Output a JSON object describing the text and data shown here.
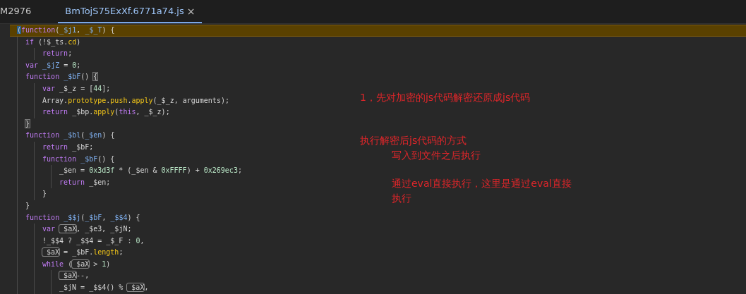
{
  "tabs": [
    {
      "label": "M2976",
      "selected": false
    },
    {
      "label": "BmTojS75ExXf.6771a74.js",
      "selected": true,
      "close_glyph": "×"
    }
  ],
  "code": {
    "lines": [
      {
        "highlighted": true,
        "tokens": [
          {
            "kind": "cursor",
            "text": "("
          },
          {
            "kind": "kw",
            "text": "function"
          },
          {
            "kind": "plain",
            "text": "("
          },
          {
            "kind": "var",
            "text": "_$j1"
          },
          {
            "kind": "plain",
            "text": ", "
          },
          {
            "kind": "var",
            "text": "_$_T"
          },
          {
            "kind": "plain",
            "text": ") {"
          }
        ],
        "children": [
          {
            "highlighted": false,
            "tokens": [
              {
                "kind": "kw",
                "text": "if"
              },
              {
                "kind": "plain",
                "text": " (!$_ts."
              },
              {
                "kind": "prop",
                "text": "cd"
              },
              {
                "kind": "plain",
                "text": ")"
              }
            ],
            "children": [
              {
                "highlighted": false,
                "tokens": [
                  {
                    "kind": "kw",
                    "text": "return"
                  },
                  {
                    "kind": "plain",
                    "text": ";"
                  }
                ]
              }
            ]
          },
          {
            "highlighted": false,
            "tokens": [
              {
                "kind": "kw",
                "text": "var "
              },
              {
                "kind": "var",
                "text": "_$jZ"
              },
              {
                "kind": "plain",
                "text": " = "
              },
              {
                "kind": "num",
                "text": "0"
              },
              {
                "kind": "plain",
                "text": ";"
              }
            ]
          },
          {
            "highlighted": false,
            "tokens": [
              {
                "kind": "kw",
                "text": "function "
              },
              {
                "kind": "var",
                "text": "_$bF"
              },
              {
                "kind": "plain",
                "text": "() "
              },
              {
                "kind": "bracket",
                "text": "{"
              }
            ],
            "children": [
              {
                "highlighted": false,
                "tokens": [
                  {
                    "kind": "kw",
                    "text": "var"
                  },
                  {
                    "kind": "plain",
                    "text": " _$_z = ["
                  },
                  {
                    "kind": "num",
                    "text": "44"
                  },
                  {
                    "kind": "plain",
                    "text": "];"
                  }
                ]
              },
              {
                "highlighted": false,
                "tokens": [
                  {
                    "kind": "plain",
                    "text": "Array."
                  },
                  {
                    "kind": "prop",
                    "text": "prototype"
                  },
                  {
                    "kind": "plain",
                    "text": "."
                  },
                  {
                    "kind": "prop",
                    "text": "push"
                  },
                  {
                    "kind": "plain",
                    "text": "."
                  },
                  {
                    "kind": "prop",
                    "text": "apply"
                  },
                  {
                    "kind": "plain",
                    "text": "(_$_z, arguments);"
                  }
                ]
              },
              {
                "highlighted": false,
                "tokens": [
                  {
                    "kind": "kw",
                    "text": "return"
                  },
                  {
                    "kind": "plain",
                    "text": " _$bp."
                  },
                  {
                    "kind": "prop",
                    "text": "apply"
                  },
                  {
                    "kind": "plain",
                    "text": "("
                  },
                  {
                    "kind": "kw",
                    "text": "this"
                  },
                  {
                    "kind": "plain",
                    "text": ", _$_z);"
                  }
                ]
              }
            ]
          },
          {
            "highlighted": false,
            "tokens": [
              {
                "kind": "bracket",
                "text": "}"
              }
            ]
          },
          {
            "highlighted": false,
            "tokens": [
              {
                "kind": "kw",
                "text": "function "
              },
              {
                "kind": "var",
                "text": "_$bl"
              },
              {
                "kind": "plain",
                "text": "("
              },
              {
                "kind": "var",
                "text": "_$en"
              },
              {
                "kind": "plain",
                "text": ") {"
              }
            ],
            "children": [
              {
                "highlighted": false,
                "tokens": [
                  {
                    "kind": "kw",
                    "text": "return"
                  },
                  {
                    "kind": "plain",
                    "text": " _$bF;"
                  }
                ]
              },
              {
                "highlighted": false,
                "tokens": [
                  {
                    "kind": "kw",
                    "text": "function "
                  },
                  {
                    "kind": "var",
                    "text": "_$bF"
                  },
                  {
                    "kind": "plain",
                    "text": "() {"
                  }
                ],
                "children": [
                  {
                    "highlighted": false,
                    "tokens": [
                      {
                        "kind": "plain",
                        "text": "_$en = "
                      },
                      {
                        "kind": "num",
                        "text": "0x3d3f"
                      },
                      {
                        "kind": "plain",
                        "text": " * (_$en & "
                      },
                      {
                        "kind": "num",
                        "text": "0xFFFF"
                      },
                      {
                        "kind": "plain",
                        "text": ") + "
                      },
                      {
                        "kind": "num",
                        "text": "0x269ec3"
                      },
                      {
                        "kind": "plain",
                        "text": ";"
                      }
                    ]
                  },
                  {
                    "highlighted": false,
                    "tokens": [
                      {
                        "kind": "kw",
                        "text": "return"
                      },
                      {
                        "kind": "plain",
                        "text": " _$en;"
                      }
                    ]
                  }
                ]
              },
              {
                "highlighted": false,
                "tokens": [
                  {
                    "kind": "plain",
                    "text": "}"
                  }
                ]
              }
            ]
          },
          {
            "highlighted": false,
            "tokens": [
              {
                "kind": "plain",
                "text": "}"
              }
            ]
          },
          {
            "highlighted": false,
            "tokens": [
              {
                "kind": "kw",
                "text": "function "
              },
              {
                "kind": "var",
                "text": "_$$j"
              },
              {
                "kind": "plain",
                "text": "("
              },
              {
                "kind": "var",
                "text": "_$bF"
              },
              {
                "kind": "plain",
                "text": ", "
              },
              {
                "kind": "var",
                "text": "_$$4"
              },
              {
                "kind": "plain",
                "text": ") {"
              }
            ],
            "children": [
              {
                "highlighted": false,
                "tokens": [
                  {
                    "kind": "kw",
                    "text": "var "
                  },
                  {
                    "kind": "match",
                    "text": "_$aX"
                  },
                  {
                    "kind": "plain",
                    "text": ", _$e3, _$jN;"
                  }
                ]
              },
              {
                "highlighted": false,
                "tokens": [
                  {
                    "kind": "plain",
                    "text": "!_$$4 ? _$$4 = _$_F : "
                  },
                  {
                    "kind": "num",
                    "text": "0"
                  },
                  {
                    "kind": "plain",
                    "text": ","
                  }
                ]
              },
              {
                "highlighted": false,
                "tokens": [
                  {
                    "kind": "match",
                    "text": "_$aX"
                  },
                  {
                    "kind": "plain",
                    "text": " = _$bF."
                  },
                  {
                    "kind": "prop",
                    "text": "length"
                  },
                  {
                    "kind": "plain",
                    "text": ";"
                  }
                ]
              },
              {
                "highlighted": false,
                "tokens": [
                  {
                    "kind": "kw",
                    "text": "while"
                  },
                  {
                    "kind": "plain",
                    "text": " ("
                  },
                  {
                    "kind": "match",
                    "text": "_$aX"
                  },
                  {
                    "kind": "plain",
                    "text": " > "
                  },
                  {
                    "kind": "num",
                    "text": "1"
                  },
                  {
                    "kind": "plain",
                    "text": ")"
                  }
                ],
                "children": [
                  {
                    "highlighted": false,
                    "tokens": [
                      {
                        "kind": "match",
                        "text": "_$aX"
                      },
                      {
                        "kind": "plain",
                        "text": "--,"
                      }
                    ]
                  },
                  {
                    "highlighted": false,
                    "tokens": [
                      {
                        "kind": "plain",
                        "text": "_$jN = _$$4() % "
                      },
                      {
                        "kind": "match",
                        "text": "_$aX"
                      },
                      {
                        "kind": "plain",
                        "text": ","
                      }
                    ]
                  }
                ]
              }
            ]
          }
        ]
      }
    ]
  },
  "notes": [
    {
      "text": "1，先对加密的js代码解密还原成js代码"
    },
    {
      "text": "执行解密后js代码的方式",
      "children": [
        {
          "text": "写入到文件之后执行"
        },
        {
          "text": "通过eval直接执行，这里是通过eval直接执行"
        }
      ]
    }
  ]
}
